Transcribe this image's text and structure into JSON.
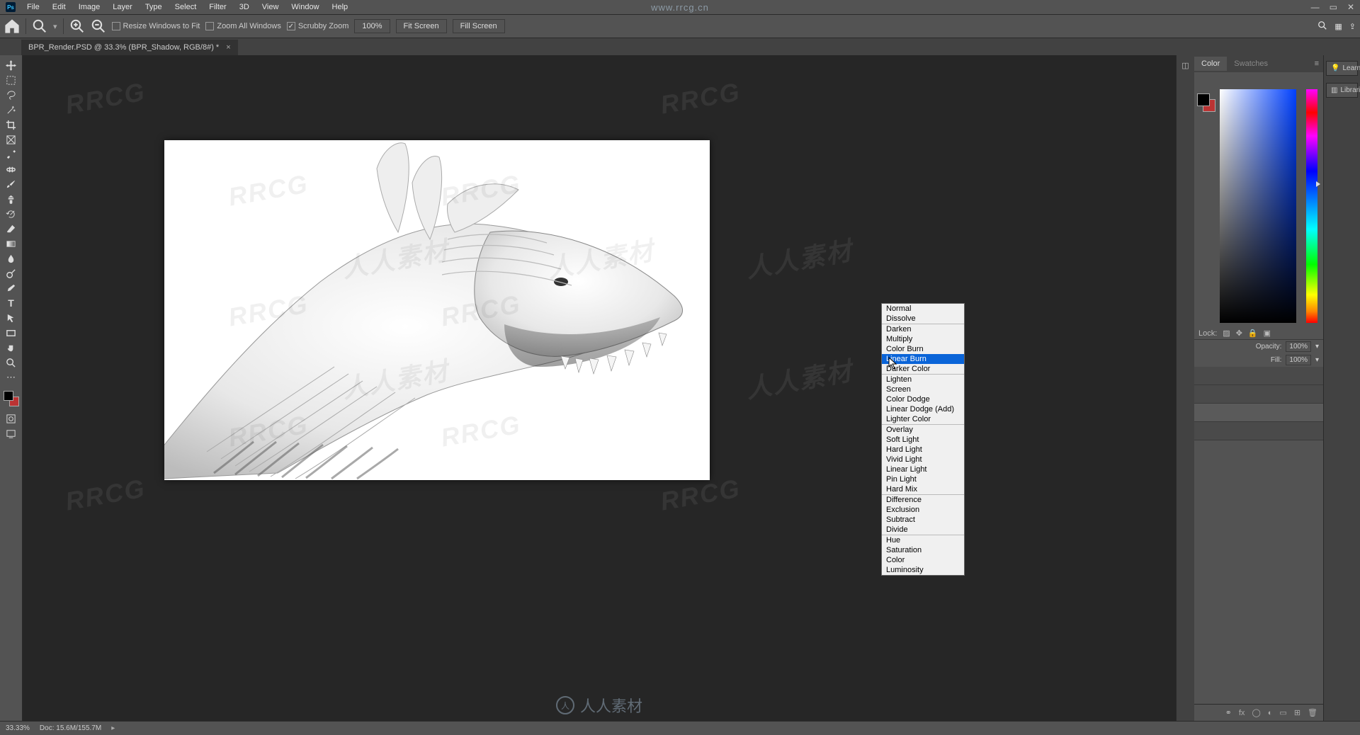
{
  "site_url": "www.rrcg.cn",
  "menu": {
    "items": [
      "File",
      "Edit",
      "Image",
      "Layer",
      "Type",
      "Select",
      "Filter",
      "3D",
      "View",
      "Window",
      "Help"
    ]
  },
  "options": {
    "resize": "Resize Windows to Fit",
    "zoom_all": "Zoom All Windows",
    "scrubby": "Scrubby Zoom",
    "zoom_pct": "100%",
    "fit": "Fit Screen",
    "fill": "Fill Screen"
  },
  "doc_tab": {
    "title": "BPR_Render.PSD @ 33.3% (BPR_Shadow, RGB/8#) *",
    "close": "×"
  },
  "right": {
    "color_tab": "Color",
    "swatches_tab": "Swatches",
    "learn": "Learn",
    "libraries": "Libraries"
  },
  "blend_modes": {
    "groups": [
      [
        "Normal",
        "Dissolve"
      ],
      [
        "Darken",
        "Multiply",
        "Color Burn",
        "Linear Burn",
        "Darker Color"
      ],
      [
        "Lighten",
        "Screen",
        "Color Dodge",
        "Linear Dodge (Add)",
        "Lighter Color"
      ],
      [
        "Overlay",
        "Soft Light",
        "Hard Light",
        "Vivid Light",
        "Linear Light",
        "Pin Light",
        "Hard Mix"
      ],
      [
        "Difference",
        "Exclusion",
        "Subtract",
        "Divide"
      ],
      [
        "Hue",
        "Saturation",
        "Color",
        "Luminosity"
      ]
    ],
    "highlighted": "Linear Burn"
  },
  "layers": {
    "opacity_label": "Opacity:",
    "opacity_val": "100%",
    "fill_label": "Fill:",
    "fill_val": "100%",
    "lock_label": "Lock:"
  },
  "status": {
    "zoom": "33.33%",
    "doc": "Doc: 15.6M/155.7M"
  },
  "center_site": "人人素材"
}
